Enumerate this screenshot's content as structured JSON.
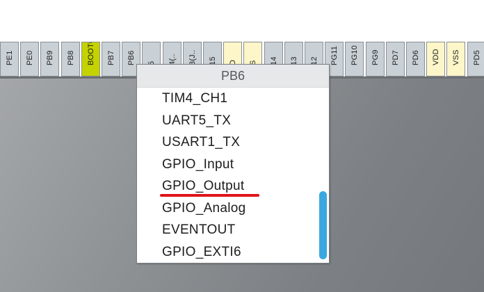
{
  "pins": [
    {
      "label": "PE1",
      "type": "io"
    },
    {
      "label": "PE0",
      "type": "io"
    },
    {
      "label": "PB9",
      "type": "io"
    },
    {
      "label": "PB8",
      "type": "io"
    },
    {
      "label": "BOOT0",
      "type": "boot"
    },
    {
      "label": "PB7",
      "type": "io"
    },
    {
      "label": "PB6",
      "type": "io"
    },
    {
      "label": "5",
      "type": "io"
    },
    {
      "label": "4(..",
      "type": "io"
    },
    {
      "label": "3(J..",
      "type": "io"
    },
    {
      "label": "15",
      "type": "io"
    },
    {
      "label": "D",
      "type": "power"
    },
    {
      "label": "S",
      "type": "power"
    },
    {
      "label": "14",
      "type": "io"
    },
    {
      "label": "13",
      "type": "io"
    },
    {
      "label": "12",
      "type": "io"
    },
    {
      "label": "PG11",
      "type": "io"
    },
    {
      "label": "PG10",
      "type": "io"
    },
    {
      "label": "PG9",
      "type": "io"
    },
    {
      "label": "PD7",
      "type": "io"
    },
    {
      "label": "PD6",
      "type": "io"
    },
    {
      "label": "VDD",
      "type": "power"
    },
    {
      "label": "VSS",
      "type": "power"
    },
    {
      "label": "PD5",
      "type": "io"
    }
  ],
  "popup": {
    "title": "PB6",
    "options": [
      "TIM4_CH1",
      "UART5_TX",
      "USART1_TX",
      "GPIO_Input",
      "GPIO_Output",
      "GPIO_Analog",
      "EVENTOUT",
      "GPIO_EXTI6"
    ],
    "highlighted_option": "GPIO_Output"
  },
  "colors": {
    "pin_io": "#c9d0d6",
    "pin_power": "#fcf6c8",
    "pin_boot": "#c4d200",
    "scroll_thumb": "#3ca6e0",
    "highlight_underline": "#e0141c"
  }
}
